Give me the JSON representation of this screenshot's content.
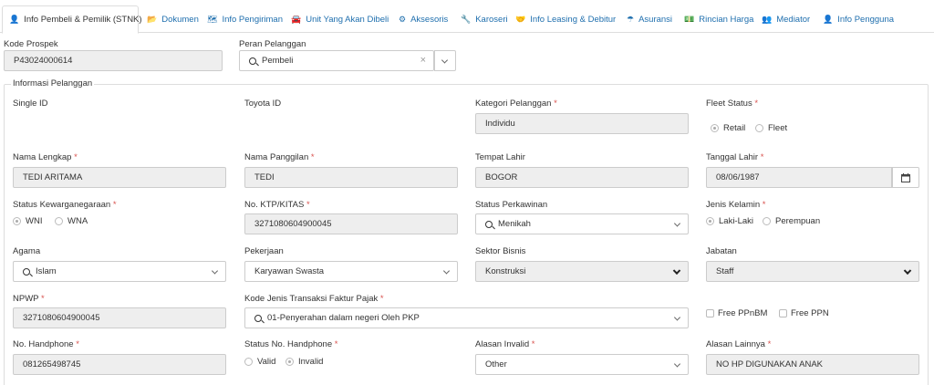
{
  "tabs": [
    {
      "label": "Info Pembeli & Pemilik (STNK)",
      "icon": "user-icon",
      "glyph": "👤"
    },
    {
      "label": "Dokumen",
      "icon": "folder-icon",
      "glyph": "📂"
    },
    {
      "label": "Info Pengiriman",
      "icon": "map-icon",
      "glyph": "🗺"
    },
    {
      "label": "Unit Yang Akan Dibeli",
      "icon": "car-icon",
      "glyph": "🚘"
    },
    {
      "label": "Aksesoris",
      "icon": "cogs-icon",
      "glyph": "⚙"
    },
    {
      "label": "Karoseri",
      "icon": "wrench-icon",
      "glyph": "🔧"
    },
    {
      "label": "Info Leasing & Debitur",
      "icon": "handshake-icon",
      "glyph": "🤝"
    },
    {
      "label": "Asuransi",
      "icon": "umbrella-icon",
      "glyph": "☂"
    },
    {
      "label": "Rincian Harga",
      "icon": "money-icon",
      "glyph": "💵"
    },
    {
      "label": "Mediator",
      "icon": "users-icon",
      "glyph": "👥"
    },
    {
      "label": "Info Pengguna",
      "icon": "user-icon",
      "glyph": "👤"
    }
  ],
  "top": {
    "kode_prospek_label": "Kode Prospek",
    "kode_prospek_value": "P43024000614",
    "peran_label": "Peran Pelanggan",
    "peran_value": "Pembeli",
    "clear_glyph": "×"
  },
  "section_title": "Informasi Pelanggan",
  "required_mark": "*",
  "fields": {
    "single_id": {
      "label": "Single ID"
    },
    "toyota_id": {
      "label": "Toyota ID"
    },
    "kategori": {
      "label": "Kategori Pelanggan",
      "value": "Individu"
    },
    "fleet_status": {
      "label": "Fleet Status",
      "options": [
        "Retail",
        "Fleet"
      ],
      "selected": "Retail"
    },
    "nama_lengkap": {
      "label": "Nama Lengkap",
      "value": "TEDI ARITAMA"
    },
    "nama_panggilan": {
      "label": "Nama Panggilan",
      "value": "TEDI"
    },
    "tempat_lahir": {
      "label": "Tempat Lahir",
      "value": "BOGOR"
    },
    "tanggal_lahir": {
      "label": "Tanggal Lahir",
      "value": "08/06/1987"
    },
    "kewarganegaraan": {
      "label": "Status Kewarganegaraan",
      "options": [
        "WNI",
        "WNA"
      ],
      "selected": "WNI"
    },
    "ktp": {
      "label": "No. KTP/KITAS",
      "value": "3271080604900045"
    },
    "perkawinan": {
      "label": "Status Perkawinan",
      "value": "Menikah"
    },
    "jenis_kelamin": {
      "label": "Jenis Kelamin",
      "options": [
        "Laki-Laki",
        "Perempuan"
      ],
      "selected": "Laki-Laki"
    },
    "agama": {
      "label": "Agama",
      "value": "Islam"
    },
    "pekerjaan": {
      "label": "Pekerjaan",
      "value": "Karyawan Swasta"
    },
    "sektor": {
      "label": "Sektor Bisnis",
      "value": "Konstruksi"
    },
    "jabatan": {
      "label": "Jabatan",
      "value": "Staff"
    },
    "npwp": {
      "label": "NPWP",
      "value": "3271080604900045"
    },
    "faktur": {
      "label": "Kode Jenis Transaksi Faktur Pajak",
      "value": "01-Penyerahan dalam negeri Oleh PKP"
    },
    "free_ppnbm": {
      "label": "Free PPnBM",
      "checked": false
    },
    "free_ppn": {
      "label": "Free PPN",
      "checked": false
    },
    "handphone": {
      "label": "No. Handphone",
      "value": "081265498745"
    },
    "status_hp": {
      "label": "Status No. Handphone",
      "options": [
        "Valid",
        "Invalid"
      ],
      "selected": "Invalid"
    },
    "alasan_invalid": {
      "label": "Alasan Invalid",
      "value": "Other"
    },
    "alasan_lainnya": {
      "label": "Alasan Lainnya",
      "value": "NO HP DIGUNAKAN ANAK"
    }
  }
}
